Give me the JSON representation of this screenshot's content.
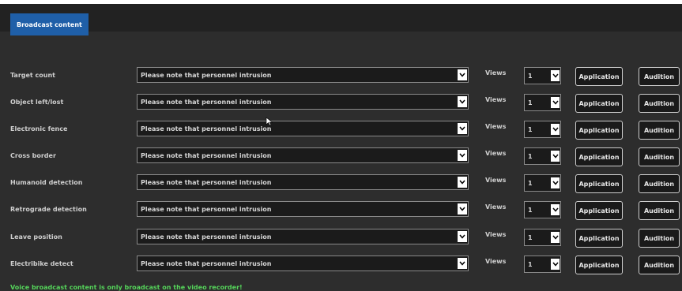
{
  "tab": {
    "label": "Broadcast content"
  },
  "columns": {
    "views_label": "Views",
    "application_label": "Application",
    "audition_label": "Audition"
  },
  "rows": [
    {
      "label": "Target count",
      "content": "Please note that personnel intrusion",
      "views": "1"
    },
    {
      "label": "Object left/lost",
      "content": "Please note that personnel intrusion",
      "views": "1"
    },
    {
      "label": "Electronic fence",
      "content": "Please note that personnel intrusion",
      "views": "1"
    },
    {
      "label": "Cross border",
      "content": "Please note that personnel intrusion",
      "views": "1"
    },
    {
      "label": "Humanoid detection",
      "content": "Please note that personnel intrusion",
      "views": "1"
    },
    {
      "label": "Retrograde detection",
      "content": "Please note that personnel intrusion",
      "views": "1"
    },
    {
      "label": "Leave position",
      "content": "Please note that personnel intrusion",
      "views": "1"
    },
    {
      "label": "Electribike detect",
      "content": "Please note that personnel intrusion",
      "views": "1"
    }
  ],
  "footer_note": "Voice broadcast content is only broadcast on the video recorder!",
  "colors": {
    "accent": "#1f5fa8",
    "note": "#55d45a",
    "background": "#2d2d2d"
  }
}
